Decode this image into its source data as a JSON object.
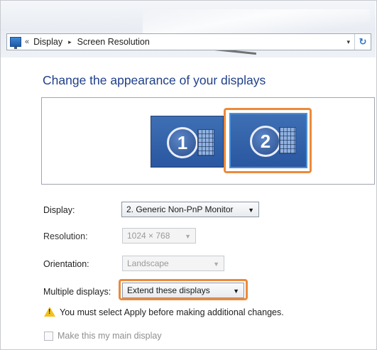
{
  "window": {
    "breadcrumbs": [
      "Display",
      "Screen Resolution"
    ],
    "chevrons": "«",
    "separator": "▸",
    "dropdown_glyph": "▾",
    "refresh_glyph": "↻",
    "icons": [
      "display-control-panel-icon",
      "refresh-icon"
    ]
  },
  "main": {
    "heading": "Change the appearance of your displays",
    "monitors": [
      {
        "label": "1",
        "selected": false
      },
      {
        "label": "2",
        "selected": true
      }
    ],
    "fields": {
      "display": {
        "label": "Display:",
        "value": "2. Generic Non-PnP Monitor"
      },
      "resolution": {
        "label": "Resolution:",
        "value": "1024 × 768",
        "disabled": true
      },
      "orientation": {
        "label": "Orientation:",
        "value": "Landscape",
        "disabled": true
      },
      "multiple_displays": {
        "label": "Multiple displays:",
        "value": "Extend these displays"
      }
    },
    "warning": "You must select Apply before making additional changes.",
    "main_display_checkbox": {
      "label": "Make this my main display",
      "checked": false,
      "disabled": true
    }
  },
  "colors": {
    "heading": "#1f3f8a",
    "highlight": "#ec8a3a",
    "monitor": "#2a57a0",
    "warning": "#f2c21b"
  }
}
